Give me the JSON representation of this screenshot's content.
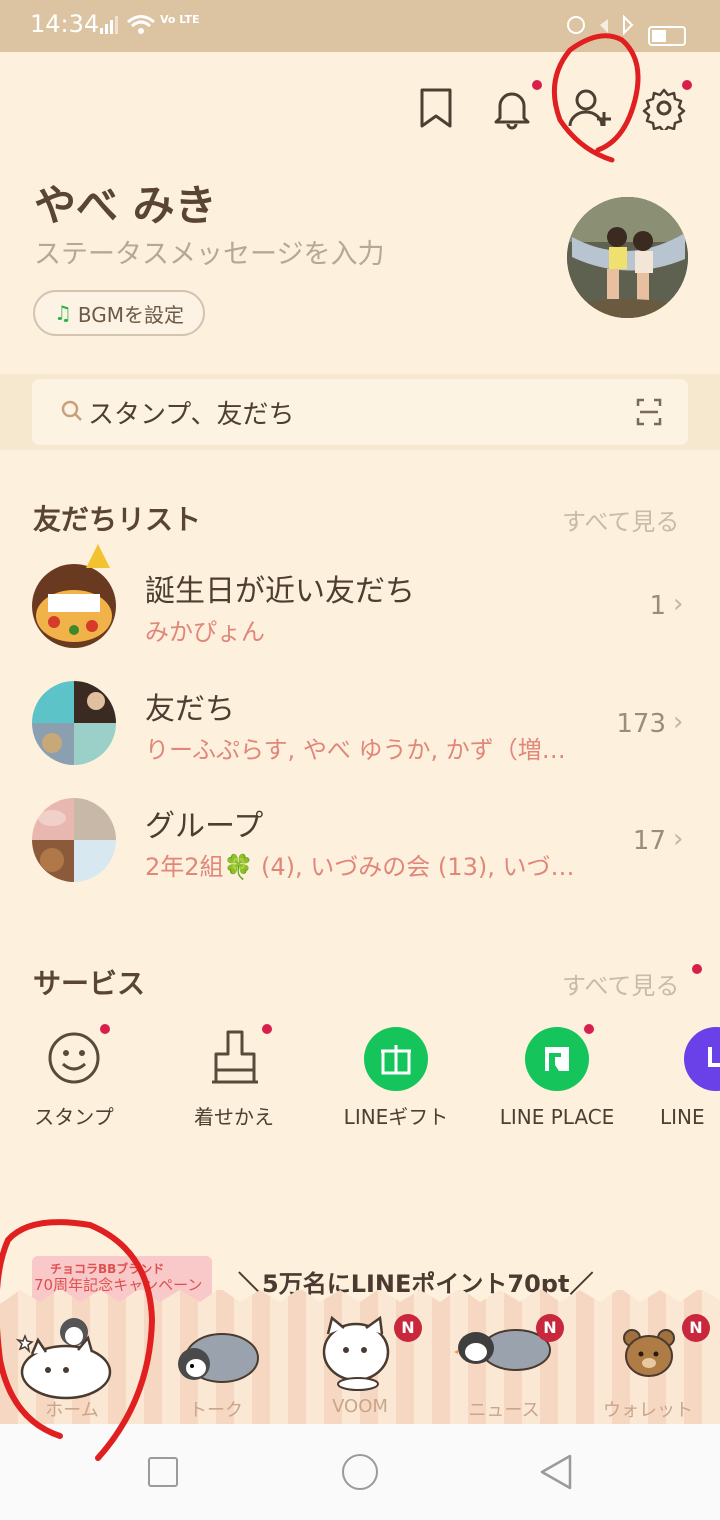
{
  "status_bar": {
    "time": "14:34",
    "network": "Vo LTE"
  },
  "header": {
    "icons": [
      "bookmark-icon",
      "bell-icon",
      "add-friend-icon",
      "gear-icon"
    ]
  },
  "profile": {
    "name": "やべ みき",
    "status_placeholder": "ステータスメッセージを入力",
    "bgm_label": "BGMを設定"
  },
  "search": {
    "placeholder": "スタンプ、友だち"
  },
  "friends_section": {
    "title": "友だちリスト",
    "see_all": "すべて見る",
    "rows": [
      {
        "title": "誕生日が近い友だち",
        "subtitle": "みかぴょん",
        "count": "1"
      },
      {
        "title": "友だち",
        "subtitle": "りーふぷらす, やべ ゆうか, かず（増…",
        "count": "173"
      },
      {
        "title": "グループ",
        "subtitle": "2年2組🍀 (4), いづみの会 (13), いづみ…",
        "count": "17"
      }
    ]
  },
  "services_section": {
    "title": "サービス",
    "see_all": "すべて見る",
    "items": [
      {
        "label": "スタンプ"
      },
      {
        "label": "着せかえ"
      },
      {
        "label": "LINEギフト"
      },
      {
        "label": "LINE PLACE"
      },
      {
        "label": "LINE"
      }
    ]
  },
  "banner": {
    "brand_text": "チョコラBBブランド",
    "campaign_text": "70周年記念キャンペーン",
    "headline": "＼5万名にLINEポイント70pt／"
  },
  "tabs": [
    {
      "label": "ホーム"
    },
    {
      "label": "トーク"
    },
    {
      "label": "VOOM",
      "badge": "N"
    },
    {
      "label": "ニュース",
      "badge": "N"
    },
    {
      "label": "ウォレット",
      "badge": "N"
    }
  ],
  "colors": {
    "accent_red": "#d6204b",
    "line_green": "#15c45a",
    "bg": "#fdf1de"
  }
}
